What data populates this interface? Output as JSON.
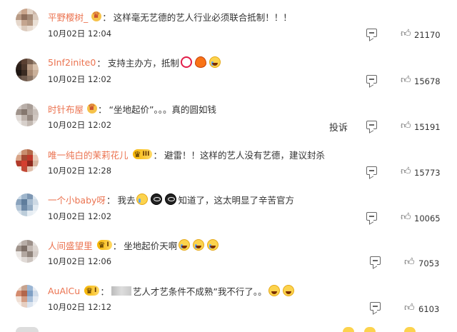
{
  "comments": [
    {
      "username": "平野樱树_",
      "text": "这样毫无艺德的艺人行业必须联合抵制！！！",
      "time": "10月02日 12:04",
      "likes": "21170",
      "badge": "crown",
      "emojis_after": []
    },
    {
      "username": "5Inf2inite0",
      "text": "支持主办方，抵制",
      "time": "10月02日 12:02",
      "likes": "15678",
      "badge": "none",
      "emojis_after": [
        "circle-icon",
        "fire-icon",
        "laugh-cry-emoji"
      ]
    },
    {
      "username": "时针布屋",
      "text": "“坐地起价”。。。真的圆如钱",
      "time": "10月02日 12:02",
      "likes": "15191",
      "badge": "crown",
      "report_label": "投诉",
      "emojis_after": []
    },
    {
      "username": "唯一纯白的茉莉花儿",
      "text": "避雷！！这样的艺人没有艺德，建议封杀",
      "time": "10月02日 12:28",
      "likes": "15773",
      "badge": "level",
      "level": "III",
      "emojis_after": []
    },
    {
      "username": "一个小baby呀",
      "text_before": "我去",
      "text_after": "知道了，这太明显了辛苦官方",
      "time": "10月02日 12:02",
      "likes": "10065",
      "badge": "none",
      "emojis_mid": [
        "cry-emoji",
        "dark-emoji",
        "dark-emoji"
      ]
    },
    {
      "username": "人间盛望里",
      "text": "坐地起价天啊",
      "time": "10月02日 12:06",
      "likes": "7053",
      "badge": "level",
      "level": "I",
      "emojis_after": [
        "laugh-emoji",
        "laugh-emoji",
        "laugh-emoji"
      ]
    },
    {
      "username": "AuAlCu",
      "text": "艺人才艺条件不成熟”我不行了。。",
      "time": "10月02日 12:12",
      "likes": "6103",
      "badge": "level",
      "level": "I",
      "emojis_after": [
        "laugh-emoji",
        "laugh-emoji"
      ]
    }
  ],
  "colors": {
    "username": "#eb7350",
    "text": "#333333",
    "icon": "#666666"
  }
}
